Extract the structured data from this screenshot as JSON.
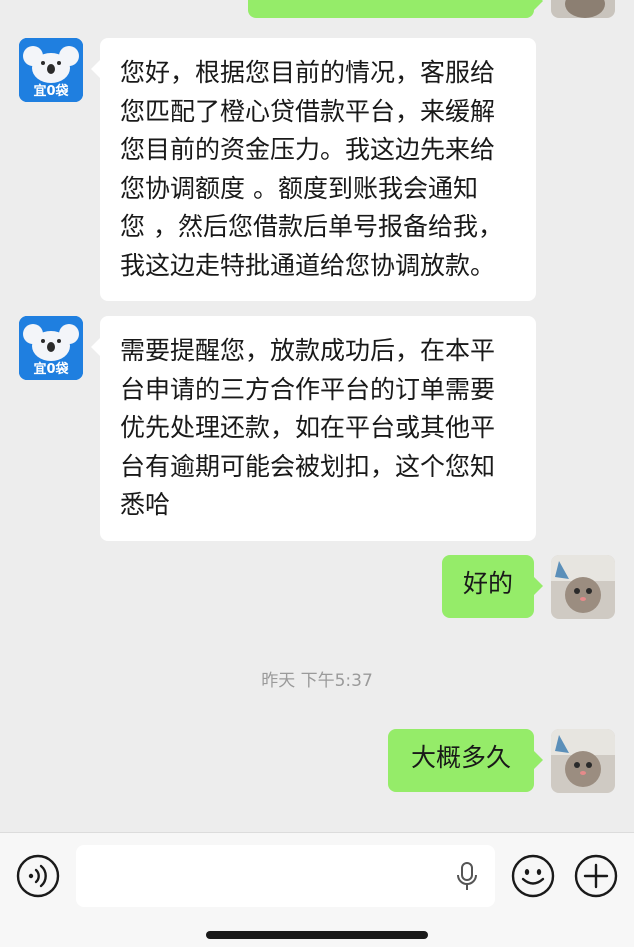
{
  "messages": [
    {
      "sender": "bot",
      "avatar_text": "宜0袋",
      "lines": [
        "您好，根据您目前的情况，客服给",
        "您匹配了橙心贷借款平台，来缓解",
        "您目前的资金压力。我这边先来给",
        "您协调额度 。额度到账我会通知",
        "您 ，然后您借款后单号报备给我，",
        "我这边走特批通道给您协调放款。"
      ]
    },
    {
      "sender": "bot",
      "avatar_text": "宜0袋",
      "lines": [
        "需要提醒您，放款成功后，在本平",
        "台申请的三方合作平台的订单需要",
        "优先处理还款，如在平台或其他平",
        "台有逾期可能会被划扣，这个您知",
        "悉哈"
      ]
    },
    {
      "sender": "me",
      "text": "好的"
    },
    {
      "sender": "me",
      "text": "大概多久"
    }
  ],
  "timestamp": "昨天 下午5:37",
  "colors": {
    "self_bubble": "#95ec69",
    "other_bubble": "#ffffff",
    "background": "#ededed",
    "bot_avatar": "#1f7fe0"
  },
  "input_bar": {
    "voice_icon": "voice-icon",
    "mic_icon": "microphone-icon",
    "emoji_icon": "emoji-icon",
    "plus_icon": "plus-icon"
  }
}
